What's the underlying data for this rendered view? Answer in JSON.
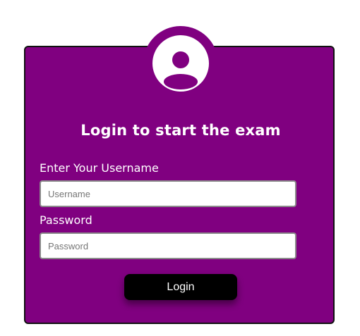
{
  "login": {
    "title": "Login to start the exam",
    "username_label": "Enter Your Username",
    "username_placeholder": "Username",
    "username_value": "",
    "password_label": "Password",
    "password_placeholder": "Password",
    "password_value": "",
    "submit_label": "Login"
  },
  "icons": {
    "avatar": "user-circle-icon"
  },
  "colors": {
    "card_background": "#800080",
    "button_background": "#000000",
    "text": "#ffffff"
  }
}
